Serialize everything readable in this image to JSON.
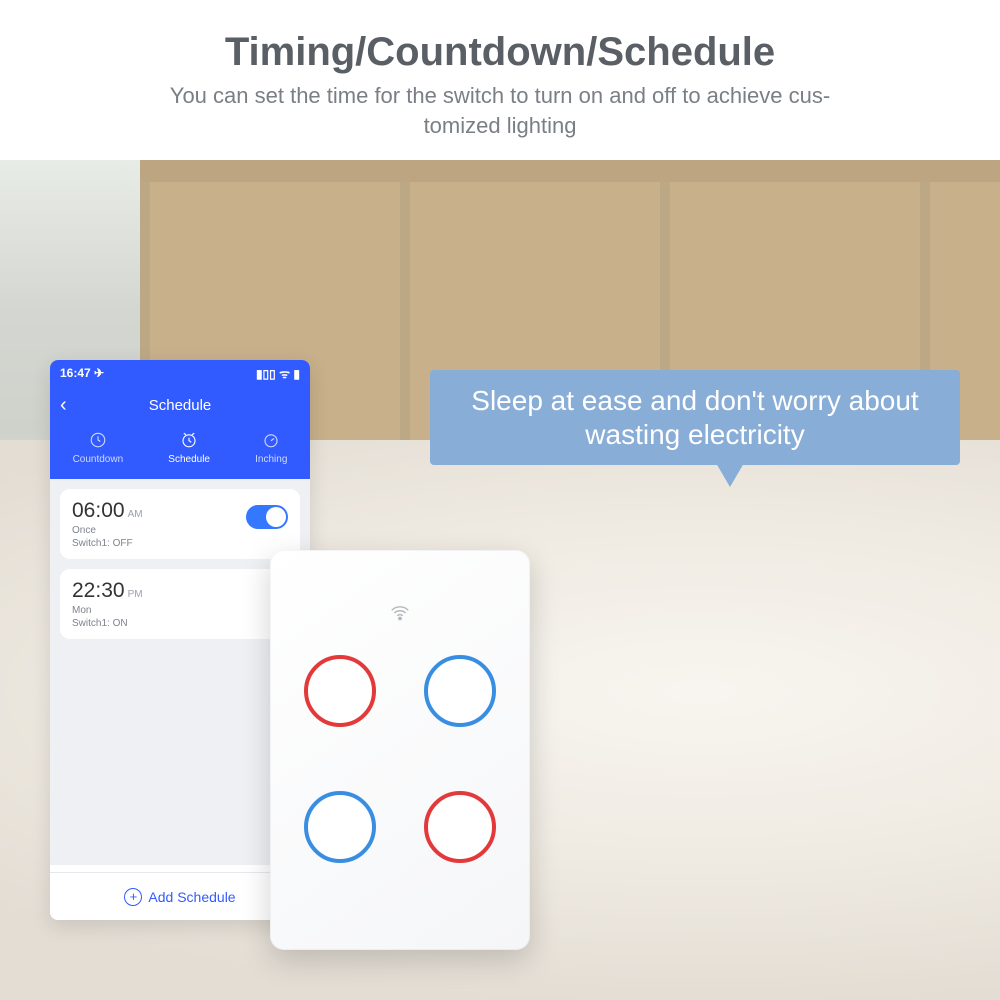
{
  "header": {
    "title": "Timing/Countdown/Schedule",
    "subtitle_line1": "You can set the time for the switch to turn on and off to achieve cus-",
    "subtitle_line2": "tomized lighting"
  },
  "bubble": "Sleep at ease and don't worry about wasting electricity",
  "phone": {
    "status_time": "16:47 ✈",
    "status_right": "▮▯▯ ᯤ ▮",
    "nav_back": "‹",
    "nav_title": "Schedule",
    "tabs": [
      {
        "label": "Countdown"
      },
      {
        "label": "Schedule"
      },
      {
        "label": "Inching"
      }
    ],
    "schedules": [
      {
        "time": "06:00",
        "ampm": "AM",
        "repeat": "Once",
        "detail": "Switch1: OFF",
        "toggle_on": true
      },
      {
        "time": "22:30",
        "ampm": "PM",
        "repeat": "Mon",
        "detail": "Switch1: ON",
        "toggle_on": false
      }
    ],
    "add_label": "Add Schedule"
  },
  "panel": {
    "buttons": [
      "red",
      "blue",
      "blue",
      "red"
    ]
  },
  "colors": {
    "brand_blue": "#325bff",
    "bubble": "#88add6"
  }
}
